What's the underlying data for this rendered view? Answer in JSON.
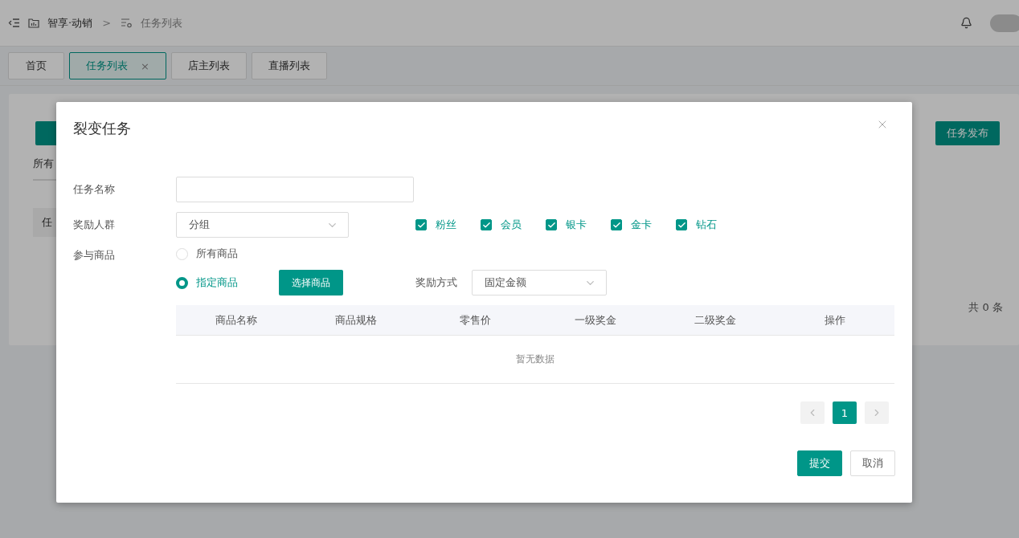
{
  "header": {
    "breadcrumb": [
      {
        "label": "智享·动销",
        "kind": "app"
      },
      {
        "label": "任务列表",
        "kind": "page"
      }
    ],
    "separator": ">"
  },
  "tabs": [
    {
      "label": "首页",
      "selected": false
    },
    {
      "label": "任务列表",
      "selected": true,
      "close": "×"
    },
    {
      "label": "店主列表",
      "selected": false
    },
    {
      "label": "直播列表",
      "selected": false
    }
  ],
  "background": {
    "filter_tab": "所有",
    "table_header": "任",
    "publish_button": "任务发布",
    "total": "共 0 条"
  },
  "modal": {
    "title": "裂变任务",
    "task_name": {
      "label": "任务名称"
    },
    "audience": {
      "label": "奖励人群",
      "select": "分组",
      "options": [
        {
          "label": "粉丝",
          "checked": true
        },
        {
          "label": "会员",
          "checked": true
        },
        {
          "label": "银卡",
          "checked": true
        },
        {
          "label": "金卡",
          "checked": true
        },
        {
          "label": "钻石",
          "checked": true
        }
      ]
    },
    "products": {
      "label": "参与商品",
      "radios": [
        {
          "label": "所有商品",
          "selected": false
        },
        {
          "label": "指定商品",
          "selected": true
        }
      ],
      "choose_button": "选择商品",
      "reward": {
        "label": "奖励方式",
        "select": "固定金额"
      }
    },
    "table": {
      "columns": [
        "商品名称",
        "商品规格",
        "零售价",
        "一级奖金",
        "二级奖金",
        "操作"
      ],
      "empty_text": "暂无数据"
    },
    "pagination": {
      "pages": [
        {
          "label": "1",
          "selected": true
        }
      ]
    },
    "buttons": [
      {
        "label": "提交",
        "kind": "primary"
      },
      {
        "label": "取消",
        "kind": "default"
      }
    ]
  }
}
